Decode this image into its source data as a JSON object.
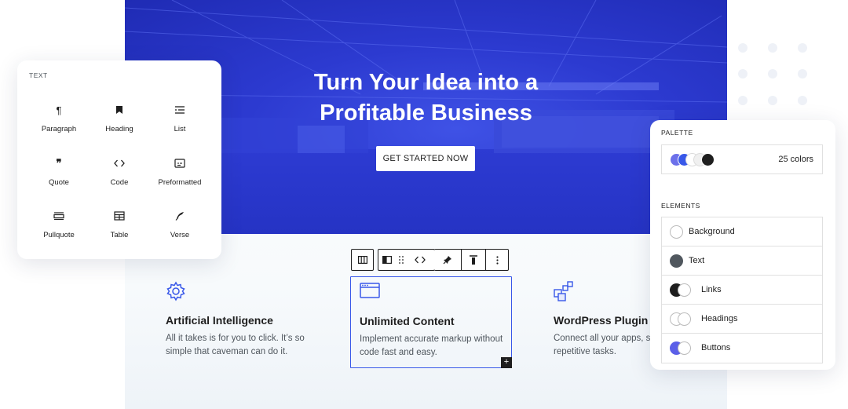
{
  "hero": {
    "title_line1": "Turn Your Idea into a",
    "title_line2": "Profitable Business",
    "cta_label": "GET STARTED NOW"
  },
  "toolbar": {
    "icons": [
      "columns-icon",
      "block-type-icon",
      "drag-handle-icon",
      "code-icon",
      "pin-icon",
      "align-top-icon",
      "more-options-icon"
    ]
  },
  "features": [
    {
      "icon": "gear-icon",
      "title": "Artificial Intelligence",
      "desc": "All it takes is for you to click. It’s so simple that caveman can do it."
    },
    {
      "icon": "browser-window-icon",
      "title": "Unlimited Content",
      "desc": "Implement accurate markup without code fast and easy."
    },
    {
      "icon": "plugin-blocks-icon",
      "title": "WordPress Plugin",
      "desc": "Connect all your apps, s repetitive tasks."
    }
  ],
  "add_block_label": "+",
  "inserter": {
    "heading": "TEXT",
    "blocks": [
      {
        "label": "Paragraph",
        "icon": "paragraph-icon",
        "glyph": "¶"
      },
      {
        "label": "Heading",
        "icon": "bookmark-icon",
        "glyph": ""
      },
      {
        "label": "List",
        "icon": "list-icon",
        "glyph": ""
      },
      {
        "label": "Quote",
        "icon": "quote-icon",
        "glyph": "❞"
      },
      {
        "label": "Code",
        "icon": "code-icon",
        "glyph": "‹›"
      },
      {
        "label": "Preformatted",
        "icon": "preformatted-icon",
        "glyph": ""
      },
      {
        "label": "Pullquote",
        "icon": "pullquote-icon",
        "glyph": ""
      },
      {
        "label": "Table",
        "icon": "table-icon",
        "glyph": ""
      },
      {
        "label": "Verse",
        "icon": "quill-icon",
        "glyph": ""
      }
    ]
  },
  "styles": {
    "palette_heading": "PALETTE",
    "palette_count": "25 colors",
    "palette_colors": [
      "#6c70ea",
      "#3858e9",
      "#ffffff",
      "#e8e8e8",
      "#1e1e1e"
    ],
    "elements_heading": "ELEMENTS",
    "elements": [
      {
        "label": "Background",
        "colors": [
          "#ffffff"
        ]
      },
      {
        "label": "Text",
        "colors": [
          "#50575e"
        ]
      },
      {
        "label": "Links",
        "colors": [
          "#1e1e1e",
          "#ffffff"
        ]
      },
      {
        "label": "Headings",
        "colors": [
          "#ffffff",
          "#ffffff"
        ]
      },
      {
        "label": "Buttons",
        "colors": [
          "#5b5fe8",
          "#ffffff"
        ]
      }
    ]
  },
  "colors": {
    "accent": "#3858e9",
    "hero_blue": "#2c3ad0",
    "dark": "#1e1e1e"
  }
}
